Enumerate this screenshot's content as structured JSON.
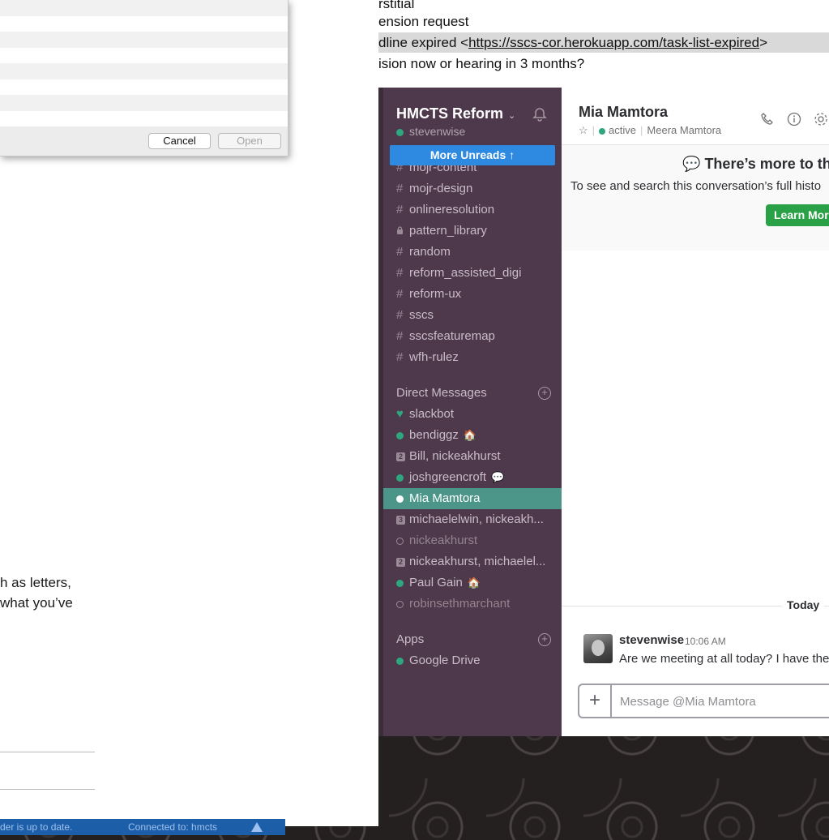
{
  "taskbar": {
    "status_left": "der is up to date.",
    "status_right": "Connected to: hmcts"
  },
  "dialog": {
    "cancel_label": "Cancel",
    "open_label": "Open"
  },
  "doc": {
    "line1": "h as letters,",
    "line2": "what you’ve"
  },
  "top_doc": {
    "line0": "rstitial",
    "line1": "ension request",
    "line2_prefix": "dline expired <",
    "line2_link": "https://sscs-cor.herokuapp.com/task-list-expired",
    "line2_suffix": ">",
    "line3": "ision now or hearing in 3 months?"
  },
  "slack": {
    "team_name": "HMCTS Reform",
    "current_user": "stevenwise",
    "more_unreads": "More Unreads",
    "channels": [
      {
        "prefix": "#",
        "name": "mojr-content"
      },
      {
        "prefix": "#",
        "name": "mojr-design"
      },
      {
        "prefix": "#",
        "name": "onlineresolution"
      },
      {
        "prefix": "lock",
        "name": "pattern_library"
      },
      {
        "prefix": "#",
        "name": "random"
      },
      {
        "prefix": "#",
        "name": "reform_assisted_digi"
      },
      {
        "prefix": "#",
        "name": "reform-ux"
      },
      {
        "prefix": "#",
        "name": "sscs"
      },
      {
        "prefix": "#",
        "name": "sscsfeaturemap"
      },
      {
        "prefix": "#",
        "name": "wfh-rulez"
      }
    ],
    "dm_header": "Direct Messages",
    "dms": [
      {
        "name": "slackbot",
        "status": "heart"
      },
      {
        "name": "bendiggz",
        "status": "online",
        "emoji": "🏠"
      },
      {
        "name": "Bill, nickeakhurst",
        "status": "group",
        "count": "2"
      },
      {
        "name": "joshgreencroft",
        "status": "online",
        "emoji": "💬"
      },
      {
        "name": "Mia Mamtora",
        "status": "active-selected"
      },
      {
        "name": "michaelelwin, nickeakh...",
        "status": "group",
        "count": "3"
      },
      {
        "name": "nickeakhurst",
        "status": "away"
      },
      {
        "name": "nickeakhurst, michaelel...",
        "status": "group",
        "count": "2"
      },
      {
        "name": "Paul Gain",
        "status": "online",
        "emoji": "🏠"
      },
      {
        "name": "robinsethmarchant",
        "status": "away"
      }
    ],
    "apps_header": "Apps",
    "apps": [
      {
        "name": "Google Drive",
        "status": "online"
      }
    ],
    "channel": {
      "title": "Mia Mamtora",
      "presence": "active",
      "full_name": "Meera Mamtora"
    },
    "banner": {
      "title": "There’s more to this",
      "subtitle": "To see and search this conversation’s full histo",
      "learn_more": "Learn More"
    },
    "day_label": "Today",
    "message": {
      "user": "stevenwise",
      "time": "10:06 AM",
      "text": "Are we meeting at all today? I have ther"
    },
    "composer_placeholder": "Message @Mia Mamtora"
  },
  "colors": {
    "sidebar": "#4d394b",
    "active_item": "#4c9689",
    "unreads_button": "#2d8ae0",
    "learn_more": "#2aa146",
    "presence": "#2ea67e"
  }
}
